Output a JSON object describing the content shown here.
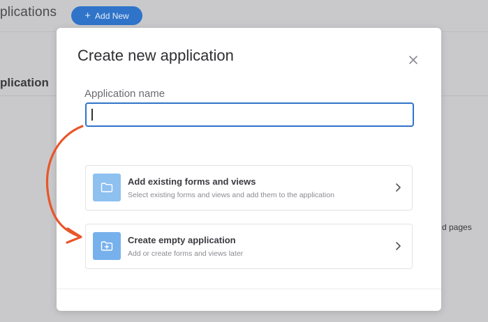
{
  "background": {
    "page_title": "plications",
    "add_new_label": "Add New",
    "section_title": "plication",
    "side_text": "d pages"
  },
  "modal": {
    "title": "Create new application",
    "field_label": "Application name",
    "input_value": "",
    "options": [
      {
        "title": "Add existing forms and views",
        "description": "Select existing forms and views and add them to the application",
        "icon": "folder-icon"
      },
      {
        "title": "Create empty application",
        "description": "Add or create forms and views later",
        "icon": "folder-plus-icon"
      }
    ]
  },
  "colors": {
    "accent": "#2f74c9",
    "option_icon_bg": "#8ec0f0",
    "annotation_arrow": "#e8562a"
  }
}
